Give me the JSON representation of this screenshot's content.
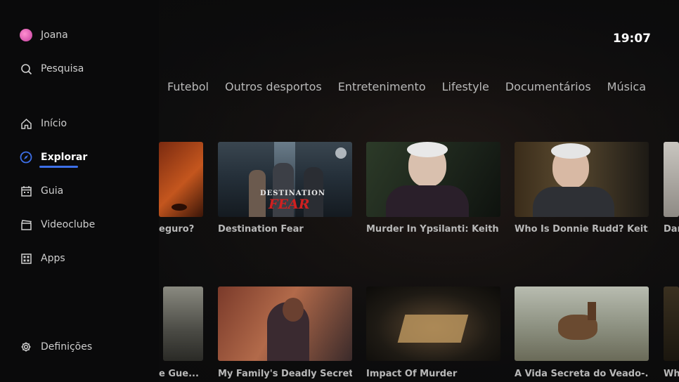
{
  "profile": {
    "name": "Joana"
  },
  "sidebar": {
    "search_label": "Pesquisa",
    "items": [
      {
        "label": "Início",
        "icon": "home-icon"
      },
      {
        "label": "Explorar",
        "icon": "compass-icon",
        "active": true
      },
      {
        "label": "Guia",
        "icon": "calendar-icon"
      },
      {
        "label": "Videoclube",
        "icon": "clapper-icon"
      },
      {
        "label": "Apps",
        "icon": "apps-grid-icon"
      }
    ],
    "settings_label": "Definições"
  },
  "clock": "19:07",
  "categories": [
    "Futebol",
    "Outros desportos",
    "Entretenimento",
    "Lifestyle",
    "Documentários",
    "Música"
  ],
  "row1": [
    {
      "title": "eguro?"
    },
    {
      "title": "Destination Fear",
      "art_top": "DESTINATION",
      "art_bottom": "FEAR"
    },
    {
      "title": "Murder In Ypsilanti: Keith ..."
    },
    {
      "title": "Who Is Donnie Rudd? Keit..."
    },
    {
      "title": "Dar"
    }
  ],
  "row2": [
    {
      "title": "e Gue..."
    },
    {
      "title": "My Family's Deadly Secret"
    },
    {
      "title": "Impact Of Murder"
    },
    {
      "title": "A Vida Secreta do Veado-..."
    },
    {
      "title": "Wh"
    }
  ],
  "accent_color": "#3d6fe8"
}
